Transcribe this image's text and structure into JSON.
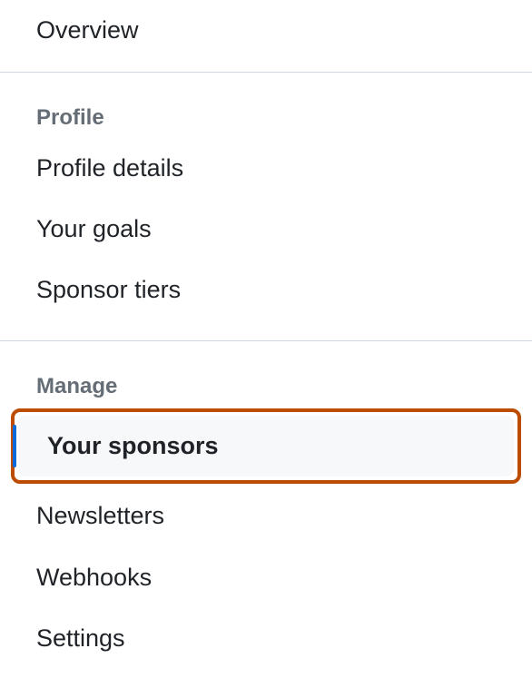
{
  "nav": {
    "overview": "Overview",
    "sections": [
      {
        "header": "Profile",
        "items": [
          {
            "label": "Profile details",
            "selected": false
          },
          {
            "label": "Your goals",
            "selected": false
          },
          {
            "label": "Sponsor tiers",
            "selected": false
          }
        ]
      },
      {
        "header": "Manage",
        "items": [
          {
            "label": "Your sponsors",
            "selected": true,
            "highlighted": true
          },
          {
            "label": "Newsletters",
            "selected": false
          },
          {
            "label": "Webhooks",
            "selected": false
          },
          {
            "label": "Settings",
            "selected": false
          }
        ]
      }
    ]
  }
}
